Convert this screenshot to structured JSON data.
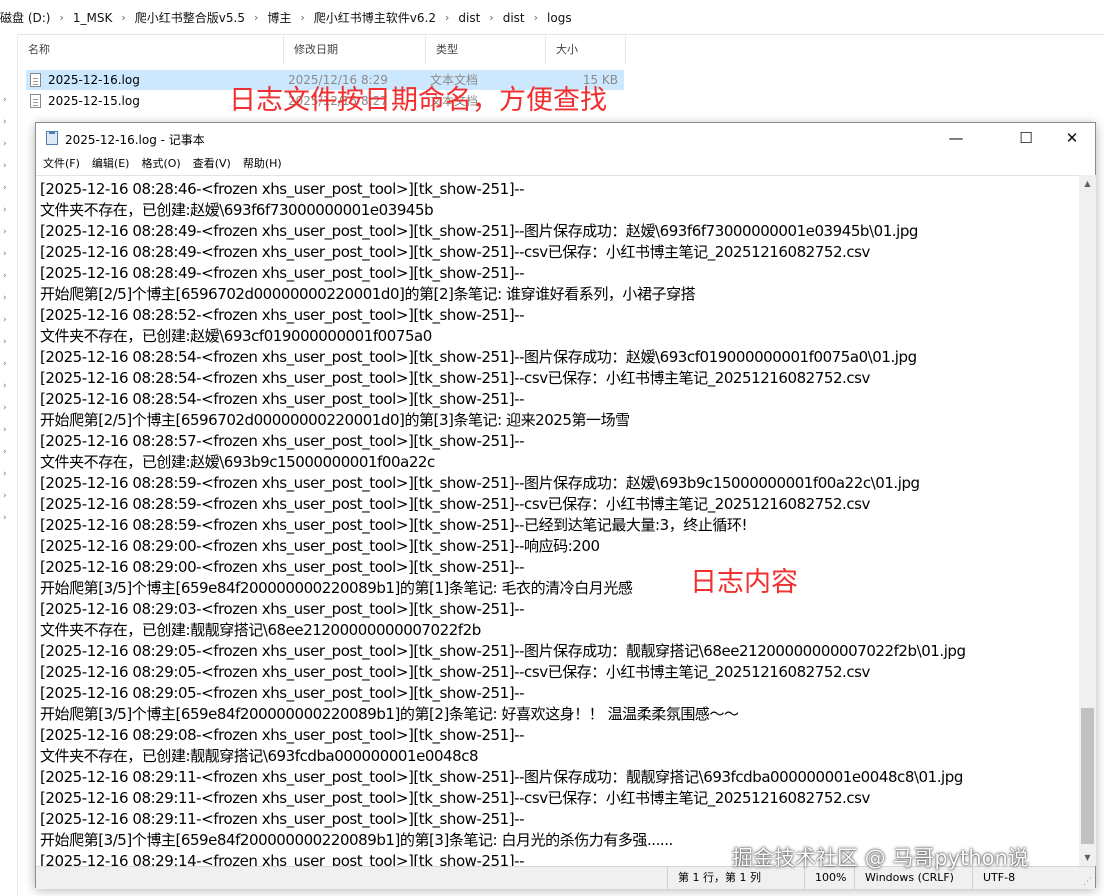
{
  "explorer": {
    "breadcrumb": [
      "磁盘 (D:)",
      "1_MSK",
      "爬小红书整合版v5.5",
      "博主",
      "爬小红书博主软件v6.2",
      "dist",
      "dist",
      "logs"
    ],
    "columns": {
      "name": "名称",
      "date": "修改日期",
      "type": "类型",
      "size": "大小"
    },
    "files": [
      {
        "name": "2025-12-16.log",
        "date": "2025/12/16 8:29",
        "type": "文本文档",
        "size": "15 KB",
        "selected": true
      },
      {
        "name": "2025-12-15.log",
        "date": "2025/12/15 8:27",
        "type": "文本文档",
        "size": "",
        "selected": false
      }
    ]
  },
  "annotations": {
    "top": "日志文件按日期命名，方便查找",
    "content": "日志内容"
  },
  "notepad": {
    "title": "2025-12-16.log - 记事本",
    "menu": [
      "文件(F)",
      "编辑(E)",
      "格式(O)",
      "查看(V)",
      "帮助(H)"
    ],
    "lines": [
      "[2025-12-16 08:28:46-<frozen xhs_user_post_tool>][tk_show-251]--",
      "文件夹不存在，已创建:赵嫒\\693f6f73000000001e03945b",
      "[2025-12-16 08:28:49-<frozen xhs_user_post_tool>][tk_show-251]--图片保存成功：赵嫒\\693f6f73000000001e03945b\\01.jpg",
      "[2025-12-16 08:28:49-<frozen xhs_user_post_tool>][tk_show-251]--csv已保存：小红书博主笔记_20251216082752.csv",
      "[2025-12-16 08:28:49-<frozen xhs_user_post_tool>][tk_show-251]--",
      "开始爬第[2/5]个博主[6596702d00000000220001d0]的第[2]条笔记: 谁穿谁好看系列，小裙子穿搭",
      "[2025-12-16 08:28:52-<frozen xhs_user_post_tool>][tk_show-251]--",
      "文件夹不存在，已创建:赵嫒\\693cf019000000001f0075a0",
      "[2025-12-16 08:28:54-<frozen xhs_user_post_tool>][tk_show-251]--图片保存成功：赵嫒\\693cf019000000001f0075a0\\01.jpg",
      "[2025-12-16 08:28:54-<frozen xhs_user_post_tool>][tk_show-251]--csv已保存：小红书博主笔记_20251216082752.csv",
      "[2025-12-16 08:28:54-<frozen xhs_user_post_tool>][tk_show-251]--",
      "开始爬第[2/5]个博主[6596702d00000000220001d0]的第[3]条笔记: 迎来2025第一场雪",
      "[2025-12-16 08:28:57-<frozen xhs_user_post_tool>][tk_show-251]--",
      "文件夹不存在，已创建:赵嫒\\693b9c15000000001f00a22c",
      "[2025-12-16 08:28:59-<frozen xhs_user_post_tool>][tk_show-251]--图片保存成功：赵嫒\\693b9c15000000001f00a22c\\01.jpg",
      "[2025-12-16 08:28:59-<frozen xhs_user_post_tool>][tk_show-251]--csv已保存：小红书博主笔记_20251216082752.csv",
      "[2025-12-16 08:28:59-<frozen xhs_user_post_tool>][tk_show-251]--已经到达笔记最大量:3，终止循环!",
      "[2025-12-16 08:29:00-<frozen xhs_user_post_tool>][tk_show-251]--响应码:200",
      "[2025-12-16 08:29:00-<frozen xhs_user_post_tool>][tk_show-251]--",
      "开始爬第[3/5]个博主[659e84f200000000220089b1]的第[1]条笔记: 毛衣的清冷白月光感",
      "[2025-12-16 08:29:03-<frozen xhs_user_post_tool>][tk_show-251]--",
      "文件夹不存在，已创建:靓靓穿搭记\\68ee21200000000007022f2b",
      "[2025-12-16 08:29:05-<frozen xhs_user_post_tool>][tk_show-251]--图片保存成功：靓靓穿搭记\\68ee21200000000007022f2b\\01.jpg",
      "[2025-12-16 08:29:05-<frozen xhs_user_post_tool>][tk_show-251]--csv已保存：小红书博主笔记_20251216082752.csv",
      "[2025-12-16 08:29:05-<frozen xhs_user_post_tool>][tk_show-251]--",
      "开始爬第[3/5]个博主[659e84f200000000220089b1]的第[2]条笔记: 好喜欢这身！！ 温温柔柔氛围感～～",
      "[2025-12-16 08:29:08-<frozen xhs_user_post_tool>][tk_show-251]--",
      "文件夹不存在，已创建:靓靓穿搭记\\693fcdba000000001e0048c8",
      "[2025-12-16 08:29:11-<frozen xhs_user_post_tool>][tk_show-251]--图片保存成功：靓靓穿搭记\\693fcdba000000001e0048c8\\01.jpg",
      "[2025-12-16 08:29:11-<frozen xhs_user_post_tool>][tk_show-251]--csv已保存：小红书博主笔记_20251216082752.csv",
      "[2025-12-16 08:29:11-<frozen xhs_user_post_tool>][tk_show-251]--",
      "开始爬第[3/5]个博主[659e84f200000000220089b1]的第[3]条笔记: 白月光的杀伤力有多强......",
      "[2025-12-16 08:29:14-<frozen xhs_user_post_tool>][tk_show-251]--"
    ],
    "status": {
      "position": "第 1 行，第 1 列",
      "zoom": "100%",
      "eol": "Windows (CRLF)",
      "encoding": "UTF-8"
    }
  },
  "watermark": "掘金技术社区 @ 马哥python说"
}
